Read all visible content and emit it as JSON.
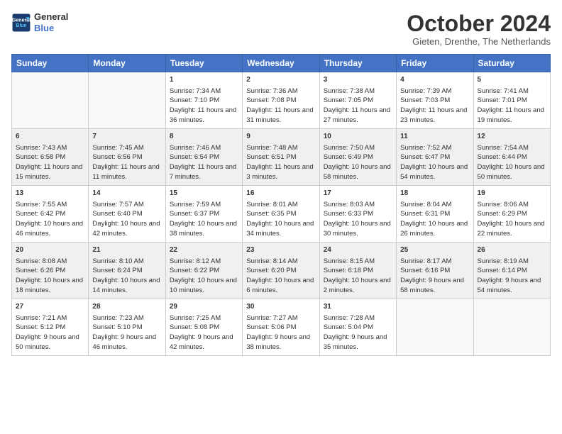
{
  "header": {
    "logo_line1": "General",
    "logo_line2": "Blue",
    "month": "October 2024",
    "location": "Gieten, Drenthe, The Netherlands"
  },
  "days": [
    "Sunday",
    "Monday",
    "Tuesday",
    "Wednesday",
    "Thursday",
    "Friday",
    "Saturday"
  ],
  "weeks": [
    [
      {
        "day": "",
        "data": ""
      },
      {
        "day": "",
        "data": ""
      },
      {
        "day": "1",
        "data": "Sunrise: 7:34 AM\nSunset: 7:10 PM\nDaylight: 11 hours and 36 minutes."
      },
      {
        "day": "2",
        "data": "Sunrise: 7:36 AM\nSunset: 7:08 PM\nDaylight: 11 hours and 31 minutes."
      },
      {
        "day": "3",
        "data": "Sunrise: 7:38 AM\nSunset: 7:05 PM\nDaylight: 11 hours and 27 minutes."
      },
      {
        "day": "4",
        "data": "Sunrise: 7:39 AM\nSunset: 7:03 PM\nDaylight: 11 hours and 23 minutes."
      },
      {
        "day": "5",
        "data": "Sunrise: 7:41 AM\nSunset: 7:01 PM\nDaylight: 11 hours and 19 minutes."
      }
    ],
    [
      {
        "day": "6",
        "data": "Sunrise: 7:43 AM\nSunset: 6:58 PM\nDaylight: 11 hours and 15 minutes."
      },
      {
        "day": "7",
        "data": "Sunrise: 7:45 AM\nSunset: 6:56 PM\nDaylight: 11 hours and 11 minutes."
      },
      {
        "day": "8",
        "data": "Sunrise: 7:46 AM\nSunset: 6:54 PM\nDaylight: 11 hours and 7 minutes."
      },
      {
        "day": "9",
        "data": "Sunrise: 7:48 AM\nSunset: 6:51 PM\nDaylight: 11 hours and 3 minutes."
      },
      {
        "day": "10",
        "data": "Sunrise: 7:50 AM\nSunset: 6:49 PM\nDaylight: 10 hours and 58 minutes."
      },
      {
        "day": "11",
        "data": "Sunrise: 7:52 AM\nSunset: 6:47 PM\nDaylight: 10 hours and 54 minutes."
      },
      {
        "day": "12",
        "data": "Sunrise: 7:54 AM\nSunset: 6:44 PM\nDaylight: 10 hours and 50 minutes."
      }
    ],
    [
      {
        "day": "13",
        "data": "Sunrise: 7:55 AM\nSunset: 6:42 PM\nDaylight: 10 hours and 46 minutes."
      },
      {
        "day": "14",
        "data": "Sunrise: 7:57 AM\nSunset: 6:40 PM\nDaylight: 10 hours and 42 minutes."
      },
      {
        "day": "15",
        "data": "Sunrise: 7:59 AM\nSunset: 6:37 PM\nDaylight: 10 hours and 38 minutes."
      },
      {
        "day": "16",
        "data": "Sunrise: 8:01 AM\nSunset: 6:35 PM\nDaylight: 10 hours and 34 minutes."
      },
      {
        "day": "17",
        "data": "Sunrise: 8:03 AM\nSunset: 6:33 PM\nDaylight: 10 hours and 30 minutes."
      },
      {
        "day": "18",
        "data": "Sunrise: 8:04 AM\nSunset: 6:31 PM\nDaylight: 10 hours and 26 minutes."
      },
      {
        "day": "19",
        "data": "Sunrise: 8:06 AM\nSunset: 6:29 PM\nDaylight: 10 hours and 22 minutes."
      }
    ],
    [
      {
        "day": "20",
        "data": "Sunrise: 8:08 AM\nSunset: 6:26 PM\nDaylight: 10 hours and 18 minutes."
      },
      {
        "day": "21",
        "data": "Sunrise: 8:10 AM\nSunset: 6:24 PM\nDaylight: 10 hours and 14 minutes."
      },
      {
        "day": "22",
        "data": "Sunrise: 8:12 AM\nSunset: 6:22 PM\nDaylight: 10 hours and 10 minutes."
      },
      {
        "day": "23",
        "data": "Sunrise: 8:14 AM\nSunset: 6:20 PM\nDaylight: 10 hours and 6 minutes."
      },
      {
        "day": "24",
        "data": "Sunrise: 8:15 AM\nSunset: 6:18 PM\nDaylight: 10 hours and 2 minutes."
      },
      {
        "day": "25",
        "data": "Sunrise: 8:17 AM\nSunset: 6:16 PM\nDaylight: 9 hours and 58 minutes."
      },
      {
        "day": "26",
        "data": "Sunrise: 8:19 AM\nSunset: 6:14 PM\nDaylight: 9 hours and 54 minutes."
      }
    ],
    [
      {
        "day": "27",
        "data": "Sunrise: 7:21 AM\nSunset: 5:12 PM\nDaylight: 9 hours and 50 minutes."
      },
      {
        "day": "28",
        "data": "Sunrise: 7:23 AM\nSunset: 5:10 PM\nDaylight: 9 hours and 46 minutes."
      },
      {
        "day": "29",
        "data": "Sunrise: 7:25 AM\nSunset: 5:08 PM\nDaylight: 9 hours and 42 minutes."
      },
      {
        "day": "30",
        "data": "Sunrise: 7:27 AM\nSunset: 5:06 PM\nDaylight: 9 hours and 38 minutes."
      },
      {
        "day": "31",
        "data": "Sunrise: 7:28 AM\nSunset: 5:04 PM\nDaylight: 9 hours and 35 minutes."
      },
      {
        "day": "",
        "data": ""
      },
      {
        "day": "",
        "data": ""
      }
    ]
  ]
}
